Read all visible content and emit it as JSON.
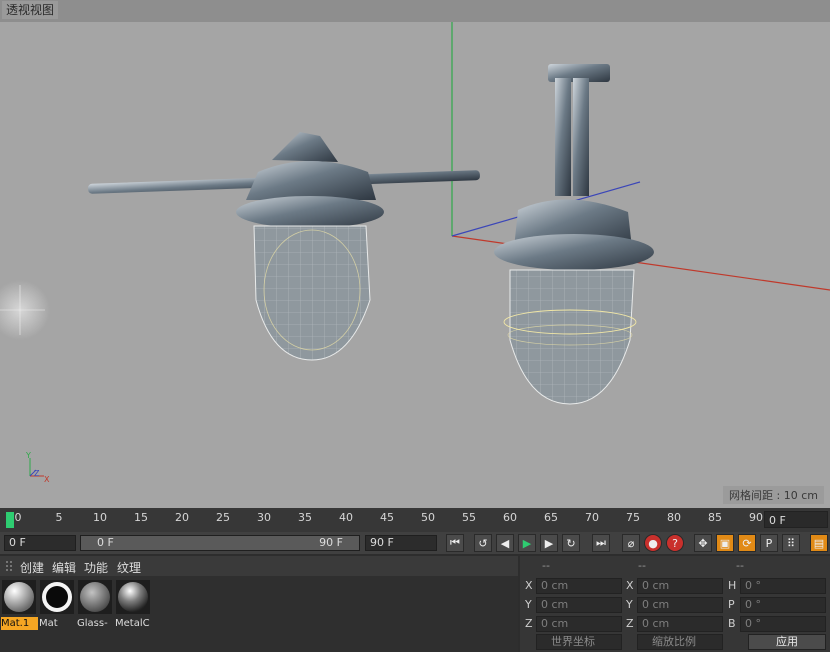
{
  "viewport": {
    "title": "透视视图",
    "grid_spacing": "网格间距 : 10 cm",
    "axis_labels": {
      "y": "Y",
      "z": "Z",
      "x": "X"
    }
  },
  "timeline": {
    "ticks": [
      "0",
      "5",
      "10",
      "15",
      "20",
      "25",
      "30",
      "35",
      "40",
      "45",
      "50",
      "55",
      "60",
      "65",
      "70",
      "75",
      "80",
      "85",
      "90"
    ],
    "end_frame_field": "0 F"
  },
  "transport": {
    "current_frame": "0 F",
    "range_start": "0 F",
    "range_end": "90 F",
    "max_frame": "90 F"
  },
  "material_manager": {
    "menu": [
      "创建",
      "编辑",
      "功能",
      "纹理"
    ],
    "materials": [
      {
        "name": "Mat.1",
        "selected": true
      },
      {
        "name": "Mat",
        "selected": false
      },
      {
        "name": "Glass-",
        "selected": false
      },
      {
        "name": "MetalC",
        "selected": false
      }
    ]
  },
  "coordinates": {
    "headers": [
      "--",
      "--",
      "--"
    ],
    "rows": [
      {
        "a": "X",
        "a_val": "0 cm",
        "b": "X",
        "b_val": "0 cm",
        "c": "H",
        "c_val": "0 °"
      },
      {
        "a": "Y",
        "a_val": "0 cm",
        "b": "Y",
        "b_val": "0 cm",
        "c": "P",
        "c_val": "0 °"
      },
      {
        "a": "Z",
        "a_val": "0 cm",
        "b": "Z",
        "b_val": "0 cm",
        "c": "B",
        "c_val": "0 °"
      }
    ],
    "space_dropdown": "世界坐标",
    "scale_dropdown": "缩放比例",
    "apply_button": "应用"
  },
  "colors": {
    "accent_orange": "#f5a623",
    "timeline_green": "#2ecc71",
    "record_red": "#c9302c",
    "active_blue": "#3a76c4"
  }
}
